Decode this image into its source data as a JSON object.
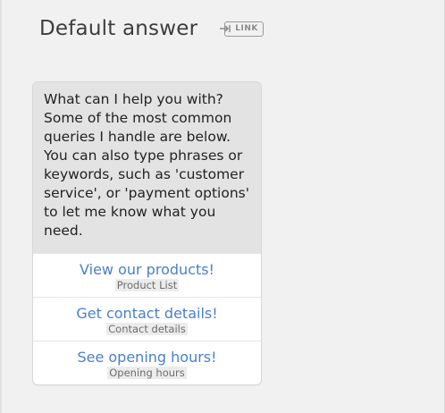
{
  "header": {
    "title": "Default answer",
    "link_badge": "LINK",
    "link_icon": "link-arrow-icon"
  },
  "card": {
    "message": "What can I help you with? Some of the most common queries I handle are below. You can also type phrases or keywords, such as 'customer service', or 'payment options' to let me know what you need.",
    "options": [
      {
        "label": "View our products!",
        "sub": "Product List"
      },
      {
        "label": "Get contact details!",
        "sub": "Contact details"
      },
      {
        "label": "See opening hours!",
        "sub": "Opening hours"
      }
    ]
  },
  "colors": {
    "accent": "#4a7fc9",
    "background": "#f1f1f1",
    "message_bg": "#e3e3e3"
  }
}
